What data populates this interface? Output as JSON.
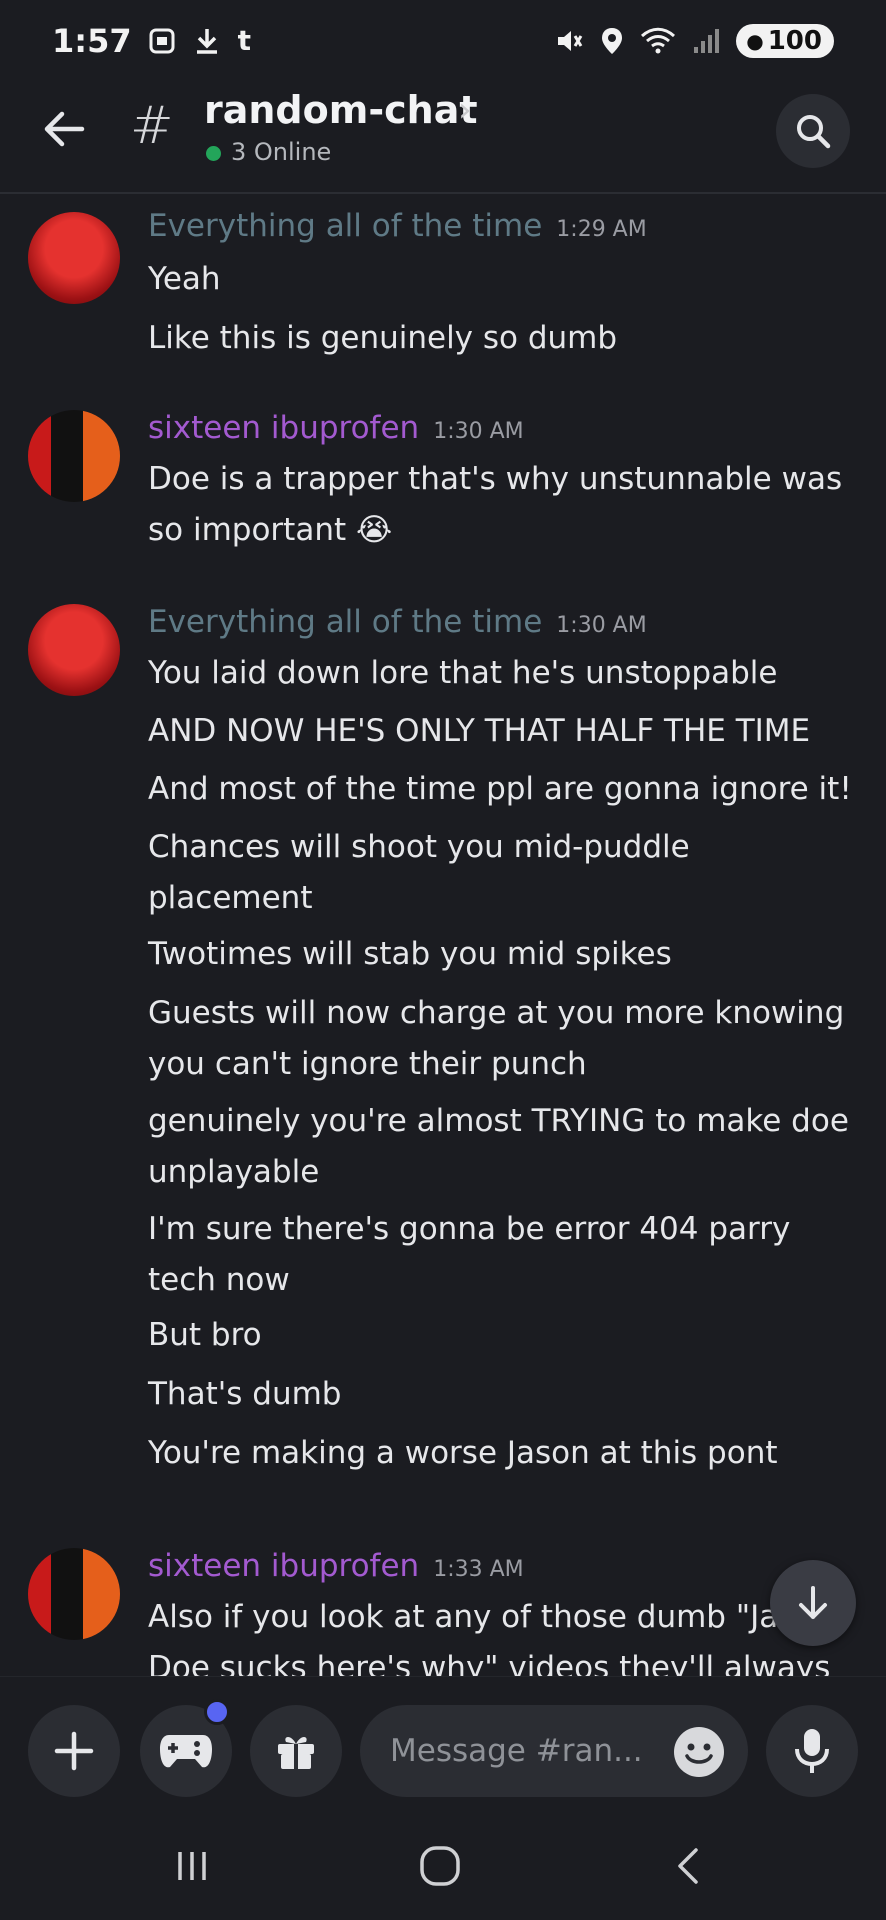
{
  "status_bar": {
    "time": "1:57",
    "battery": "100",
    "signal_label": "5"
  },
  "header": {
    "channel": "random-chat",
    "online": "3 Online"
  },
  "messages": [
    {
      "author": "Everything all of the time",
      "time": "1:29 AM",
      "color": "#5f7a86",
      "lines": [
        "Yeah",
        "Like this is genuinely so dumb"
      ]
    },
    {
      "author": "sixteen ibuprofen",
      "time": "1:30 AM",
      "color": "#a35ad0",
      "lines": [
        "Doe is a trapper that's why unstunnable was so important 😭"
      ]
    },
    {
      "author": "Everything all of the time",
      "time": "1:30 AM",
      "color": "#5f7a86",
      "lines": [
        "You laid down lore that he's unstoppable",
        "AND NOW HE'S ONLY THAT HALF THE TIME",
        "And most of the time ppl are gonna ignore it!",
        "Chances will shoot you mid-puddle placement",
        "Twotimes will stab you mid spikes",
        "Guests will now charge at you more knowing you can't ignore their punch",
        "genuinely you're almost TRYING to make doe unplayable",
        "I'm sure there's gonna be error 404 parry tech now",
        "But bro",
        "That's dumb",
        "You're making a worse Jason at this pont"
      ]
    },
    {
      "author": "sixteen ibuprofen",
      "time": "1:33 AM",
      "color": "#a35ad0",
      "lines": [
        "Also if you look at any of those dumb \"Jason Doe sucks here's why\" videos they'll always"
      ]
    }
  ],
  "composer": {
    "placeholder": "Message #ran..."
  },
  "icons": [
    "back-arrow-icon",
    "hash-icon",
    "chevron-right-icon",
    "search-icon",
    "plus-icon",
    "gamepad-icon",
    "gift-icon",
    "emoji-icon",
    "microphone-icon",
    "arrow-down-icon",
    "nav-recents-icon",
    "nav-home-icon",
    "nav-back-icon"
  ]
}
